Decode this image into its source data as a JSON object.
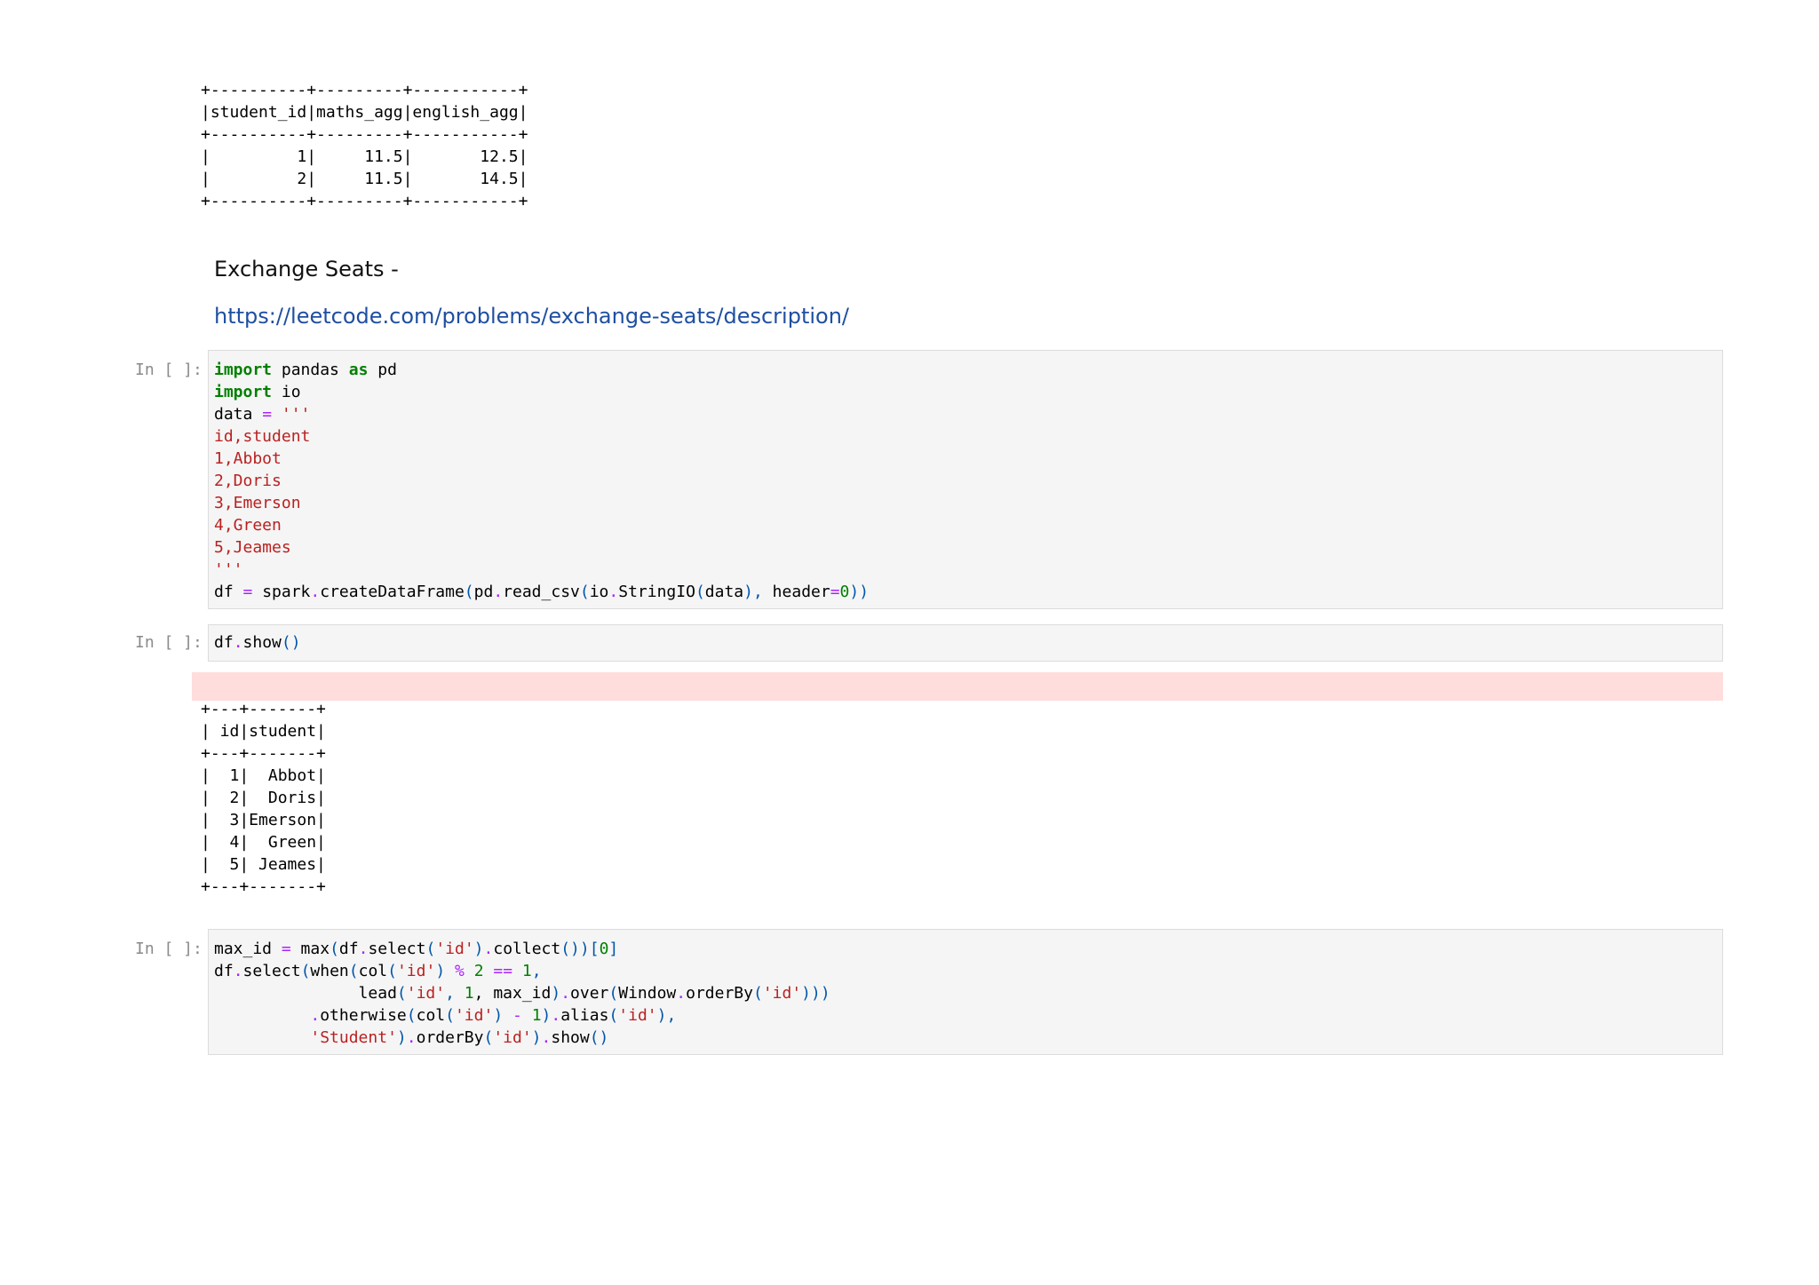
{
  "output_table_1": "+----------+---------+-----------+\n|student_id|maths_agg|english_agg|\n+----------+---------+-----------+\n|         1|     11.5|       12.5|\n|         2|     11.5|       14.5|\n+----------+---------+-----------+",
  "markdown": {
    "heading": "Exchange Seats -",
    "link": "https://leetcode.com/problems/exchange-seats/description/"
  },
  "cells": [
    {
      "prompt": "In [ ]:"
    },
    {
      "prompt": "In [ ]:"
    },
    {
      "prompt": "In [ ]:"
    }
  ],
  "code": {
    "c1": {
      "import": "import",
      "pandas": " pandas ",
      "as": "as",
      "pd": " pd",
      "import2": "import",
      "io": " io",
      "data_var": "data ",
      "eq": "=",
      "triple": " '''",
      "csv": "id,student\n1,Abbot\n2,Doris\n3,Emerson\n4,Green\n5,Jeames\n'''",
      "df": "df ",
      "eq2": "=",
      "spark": " spark",
      "dot1": ".",
      "create": "createDataFrame",
      "lp1": "(",
      "pd2": "pd",
      "dot2": ".",
      "read_csv": "read_csv",
      "lp2": "(",
      "io2": "io",
      "dot3": ".",
      "stringio": "StringIO",
      "lp3": "(",
      "data2": "data",
      "rp1": "),",
      "header": " header",
      "eq3": "=",
      "zero": "0",
      "rp2": "))"
    },
    "c2": {
      "df": "df",
      "dot": ".",
      "show": "show",
      "paren": "()"
    },
    "c3": {
      "l1a": "max_id ",
      "l1eq": "=",
      "l1b": " max",
      "l1c": "(",
      "l1d": "df",
      "l1e": ".",
      "l1f": "select",
      "l1g": "(",
      "l1h": "'id'",
      "l1i": ")",
      "l1j": ".",
      "l1k": "collect",
      "l1l": "())[",
      "l1m": "0",
      "l1n": "]",
      "l2a": "df",
      "l2b": ".",
      "l2c": "select",
      "l2d": "(",
      "l2e": "when",
      "l2f": "(",
      "l2g": "col",
      "l2h": "(",
      "l2i": "'id'",
      "l2j": ") ",
      "l2k": "%",
      "l2l": " ",
      "l2m": "2",
      "l2n": " ",
      "l2o": "==",
      "l2p": " ",
      "l2q": "1",
      "l2r": ",",
      "l3a": "               lead",
      "l3b": "(",
      "l3c": "'id'",
      "l3d": ", ",
      "l3e": "1",
      "l3f": ", max_id",
      "l3g": ")",
      "l3h": ".",
      "l3i": "over",
      "l3j": "(",
      "l3k": "Window",
      "l3l": ".",
      "l3m": "orderBy",
      "l3n": "(",
      "l3o": "'id'",
      "l3p": ")))",
      "l4a": "          ",
      "l4b": ".",
      "l4c": "otherwise",
      "l4d": "(",
      "l4e": "col",
      "l4f": "(",
      "l4g": "'id'",
      "l4h": ") ",
      "l4i": "-",
      "l4j": " ",
      "l4k": "1",
      "l4l": ")",
      "l4m": ".",
      "l4n": "alias",
      "l4o": "(",
      "l4p": "'id'",
      "l4q": "),",
      "l5a": "          ",
      "l5b": "'Student'",
      "l5c": ")",
      "l5d": ".",
      "l5e": "orderBy",
      "l5f": "(",
      "l5g": "'id'",
      "l5h": ")",
      "l5i": ".",
      "l5j": "show",
      "l5k": "()"
    }
  },
  "output_table_2": "+---+-------+\n| id|student|\n+---+-------+\n|  1|  Abbot|\n|  2|  Doris|\n|  3|Emerson|\n|  4|  Green|\n|  5| Jeames|\n+---+-------+",
  "colors": {
    "keyword": "#008000",
    "string": "#ba2121",
    "operator": "#aa22ff",
    "link": "#1f4fa1",
    "stderr_bg": "#ffdddd"
  }
}
